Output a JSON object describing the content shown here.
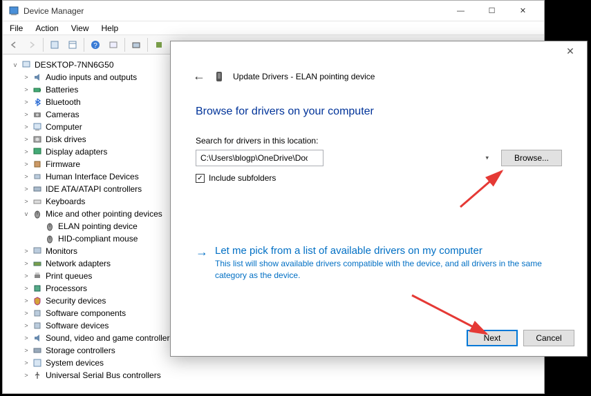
{
  "window": {
    "title": "Device Manager"
  },
  "menubar": [
    "File",
    "Action",
    "View",
    "Help"
  ],
  "tree": {
    "root": "DESKTOP-7NN6G50",
    "nodes": [
      {
        "label": "Audio inputs and outputs",
        "exp": ">"
      },
      {
        "label": "Batteries",
        "exp": ">"
      },
      {
        "label": "Bluetooth",
        "exp": ">"
      },
      {
        "label": "Cameras",
        "exp": ">"
      },
      {
        "label": "Computer",
        "exp": ">"
      },
      {
        "label": "Disk drives",
        "exp": ">"
      },
      {
        "label": "Display adapters",
        "exp": ">"
      },
      {
        "label": "Firmware",
        "exp": ">"
      },
      {
        "label": "Human Interface Devices",
        "exp": ">"
      },
      {
        "label": "IDE ATA/ATAPI controllers",
        "exp": ">"
      },
      {
        "label": "Keyboards",
        "exp": ">"
      },
      {
        "label": "Mice and other pointing devices",
        "exp": "v",
        "children": [
          {
            "label": "ELAN pointing device"
          },
          {
            "label": "HID-compliant mouse"
          }
        ]
      },
      {
        "label": "Monitors",
        "exp": ">"
      },
      {
        "label": "Network adapters",
        "exp": ">"
      },
      {
        "label": "Print queues",
        "exp": ">"
      },
      {
        "label": "Processors",
        "exp": ">"
      },
      {
        "label": "Security devices",
        "exp": ">"
      },
      {
        "label": "Software components",
        "exp": ">"
      },
      {
        "label": "Software devices",
        "exp": ">"
      },
      {
        "label": "Sound, video and game controllers",
        "exp": ">"
      },
      {
        "label": "Storage controllers",
        "exp": ">"
      },
      {
        "label": "System devices",
        "exp": ">"
      },
      {
        "label": "Universal Serial Bus controllers",
        "exp": ">"
      }
    ]
  },
  "dialog": {
    "title": "Update Drivers - ELAN pointing device",
    "heading": "Browse for drivers on your computer",
    "search_label": "Search for drivers in this location:",
    "path_value": "C:\\Users\\blogp\\OneDrive\\Documents",
    "browse_label": "Browse...",
    "include_subfolders": "Include subfolders",
    "include_checked": true,
    "pick_title": "Let me pick from a list of available drivers on my computer",
    "pick_desc": "This list will show available drivers compatible with the device, and all drivers in the same category as the device.",
    "next_label": "Next",
    "cancel_label": "Cancel"
  }
}
